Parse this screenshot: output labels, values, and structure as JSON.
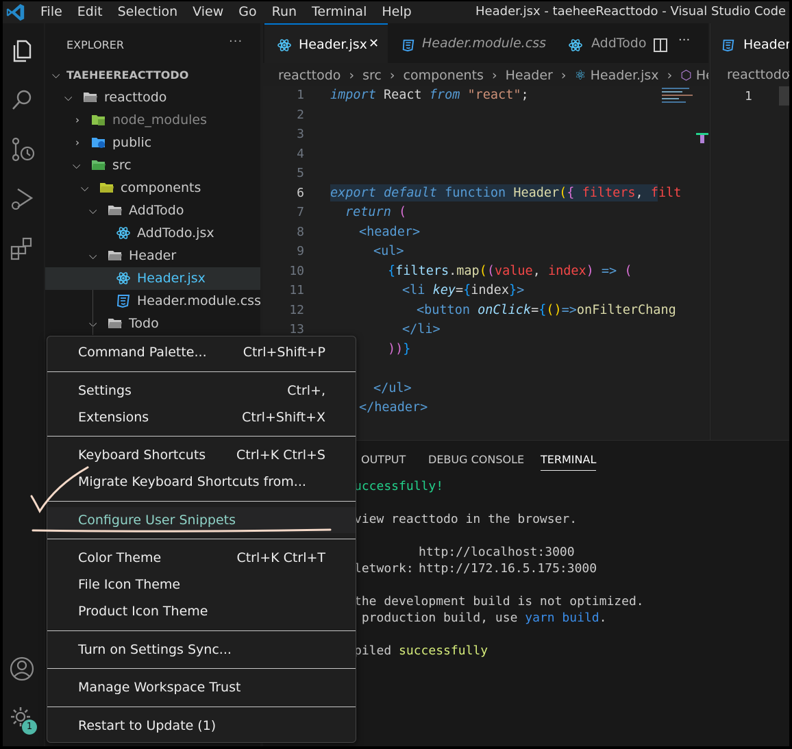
{
  "window": {
    "title": "Header.jsx - taeheeReacttodo - Visual Studio Code",
    "menu": [
      "File",
      "Edit",
      "Selection",
      "View",
      "Go",
      "Run",
      "Terminal",
      "Help"
    ]
  },
  "activity_bar": {
    "badge": "1"
  },
  "explorer": {
    "title": "EXPLORER",
    "more": "···",
    "root": "TAEHEEREACTTODO",
    "tree": [
      {
        "label": "reacttodo"
      },
      {
        "label": "node_modules"
      },
      {
        "label": "public"
      },
      {
        "label": "src"
      },
      {
        "label": "components"
      },
      {
        "label": "AddTodo"
      },
      {
        "label": "AddTodo.jsx"
      },
      {
        "label": "Header"
      },
      {
        "label": "Header.jsx"
      },
      {
        "label": "Header.module.css"
      },
      {
        "label": "Todo"
      }
    ]
  },
  "editor": {
    "tabs": [
      {
        "label": "Header.jsx",
        "close": "✕"
      },
      {
        "label": "Header.module.css"
      },
      {
        "label": "AddTodo"
      }
    ],
    "right_tab": "Header.r",
    "breadcrumb": [
      "reacttodo",
      "src",
      "components",
      "Header",
      "Header.jsx",
      "Header"
    ],
    "right_breadcrumb": "reacttodo",
    "right_line": "1",
    "line_numbers": [
      "1",
      "2",
      "3",
      "4",
      "5",
      "6",
      "7",
      "8",
      "9",
      "10",
      "11",
      "12",
      "13"
    ]
  },
  "panel": {
    "tabs": [
      "OUTPUT",
      "DEBUG CONSOLE",
      "TERMINAL"
    ],
    "active_tab": "TERMINAL",
    "terminal": {
      "l1": "uccessfully!",
      "l2": "view reacttodo in the browser.",
      "l3a": "http://localhost:3000",
      "l4a": "letwork:",
      "l4b": "http://172.16.5.175:3000",
      "l5": "the development build is not optimized.",
      "l6a": " production build, use ",
      "l6b": "yarn build",
      "l6c": ".",
      "l7a": "piled ",
      "l7b": "successfully"
    }
  },
  "context_menu": {
    "items": [
      {
        "label": "Command Palette...",
        "shortcut": "Ctrl+Shift+P"
      },
      {
        "label": "Settings",
        "shortcut": "Ctrl+,"
      },
      {
        "label": "Extensions",
        "shortcut": "Ctrl+Shift+X"
      },
      {
        "label": "Keyboard Shortcuts",
        "shortcut": "Ctrl+K Ctrl+S"
      },
      {
        "label": "Migrate Keyboard Shortcuts from...",
        "shortcut": ""
      },
      {
        "label": "Configure User Snippets",
        "shortcut": ""
      },
      {
        "label": "Color Theme",
        "shortcut": "Ctrl+K Ctrl+T"
      },
      {
        "label": "File Icon Theme",
        "shortcut": ""
      },
      {
        "label": "Product Icon Theme",
        "shortcut": ""
      },
      {
        "label": "Turn on Settings Sync...",
        "shortcut": ""
      },
      {
        "label": "Manage Workspace Trust",
        "shortcut": ""
      },
      {
        "label": "Restart to Update (1)",
        "shortcut": ""
      }
    ]
  }
}
